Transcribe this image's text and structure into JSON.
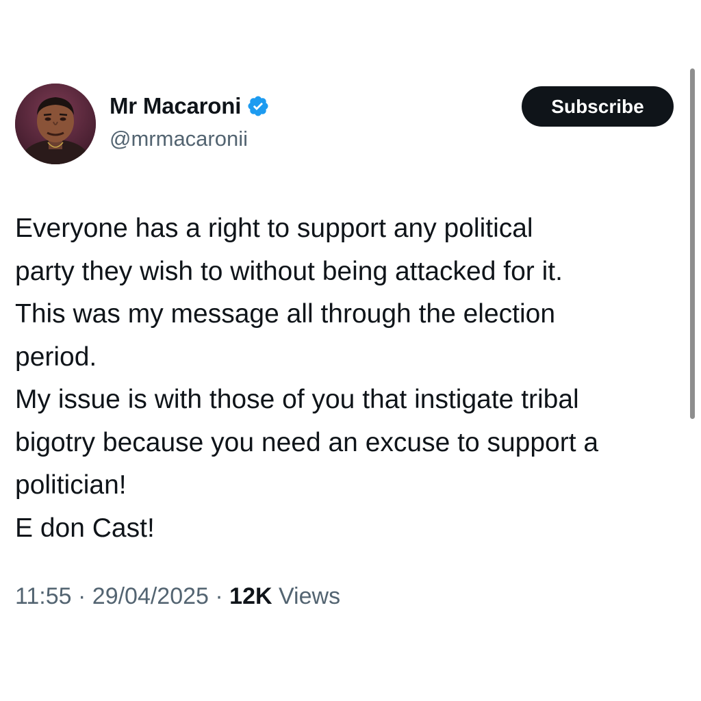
{
  "author": {
    "display_name": "Mr Macaroni",
    "handle": "@mrmacaronii",
    "verified_icon": "verified-badge-icon",
    "verified_color": "#1d9bf0"
  },
  "subscribe_button": {
    "label": "Subscribe"
  },
  "tweet": {
    "lines": [
      "Everyone has a right to support any political",
      "party they wish to without being attacked for it.",
      "This was my message all through the election",
      "period.",
      "My issue is with those of you that instigate tribal",
      "bigotry because you need an excuse to support a",
      "politician!",
      "E don Cast!"
    ]
  },
  "meta": {
    "time": "11:55",
    "separator": " · ",
    "date": "29/04/2025",
    "views_count": "12K",
    "views_label": " Views"
  },
  "colors": {
    "text_primary": "#0f1419",
    "text_secondary": "#536471",
    "button_bg": "#0f1419",
    "button_text": "#ffffff"
  }
}
